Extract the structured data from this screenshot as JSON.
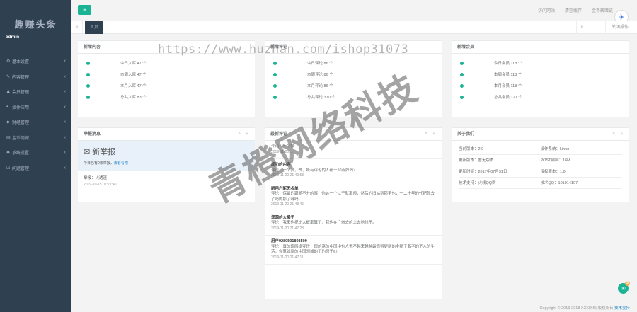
{
  "sidebar": {
    "logo": "趣赚头条",
    "user": "admin",
    "items": [
      {
        "label": "基本设置"
      },
      {
        "label": "内容管理"
      },
      {
        "label": "会员管理"
      },
      {
        "label": "插件应用"
      },
      {
        "label": "财经管理"
      },
      {
        "label": "金币商城"
      },
      {
        "label": "系统设置"
      },
      {
        "label": "问题管理"
      }
    ]
  },
  "top": {
    "menu_icon": "≡",
    "links": [
      "访问网站",
      "清空缓存",
      "金币转赠链"
    ]
  },
  "tabs": {
    "active": "首页",
    "right": "关闭操作"
  },
  "panels": {
    "p1": {
      "title": "新增内容",
      "rows": [
        "今日入库 47 个",
        "本周入库 47 个",
        "本月入库 47 个",
        "总共入库 83 个"
      ]
    },
    "p2": {
      "title": "新增评论",
      "rows": [
        "今日评论 86 个",
        "本周评论 86 个",
        "本月评论 86 个",
        "总共评论 370 个"
      ]
    },
    "p3": {
      "title": "新增会员",
      "rows": [
        "今日会员 118 个",
        "本周会员 118 个",
        "本月会员 118 个",
        "总共会员 121 个"
      ]
    },
    "report": {
      "title": "举报消息",
      "big": "新举报",
      "sub": "今日已有0条举报，",
      "link": "去看看吧",
      "item_label": "举报：火透渣",
      "item_time": "2019-10-15 02:22:40"
    },
    "comments": {
      "title": "最新评论",
      "items": [
        {
          "n": "评论：一个赞",
          "t": "2019-11-20 ..."
        },
        {
          "n": "成功的内容",
          "c": "评论：一个赞，赞，所有评论的人都十10点好吗？",
          "t": "2019-11-20 21:49:58"
        },
        {
          "n": "新用户昵无名单",
          "c": "评论：保留的跟随不分的事，你这一个以子就率师，然后的旧站到那里也，一二十年的代把就去了吗的那了呀吗。",
          "t": "2019-11-20 21:48:45"
        },
        {
          "n": "郑源的大猴子",
          "c": "评论：我来也把比大概率算了，我也在广州去的上去地线不。",
          "t": "2019-11-20 21:47:23"
        },
        {
          "n": "用户9280501808509",
          "c": "评论：真的现网络变迁，现的寒的中国中也人无不越来越越最值得更新的全新了名字的下人的生活，你就如原的中国领域的了的原子心",
          "t": "2019-11-20 21:47:11"
        }
      ]
    },
    "about": {
      "title": "关于我们",
      "rows": [
        [
          "当前版本：2.0",
          "操作系统：Linux"
        ],
        [
          "更新版本：暂无版本",
          "POST限制：16M"
        ],
        [
          "更新时间：2017年07月31日",
          "授权版本：1.0"
        ],
        [
          "技术支持：火线QQ群",
          "技术QQ：101014107"
        ]
      ],
      "link": "火线QQ群"
    }
  },
  "watermark": "https://www.huzhan.com/ishop31073",
  "watermark2": "青橙网络科技",
  "footer": {
    "text": "Copyright © 2013-2018 XXX网络 版权所有",
    "link": "技术支持"
  },
  "chat_badge": "5"
}
